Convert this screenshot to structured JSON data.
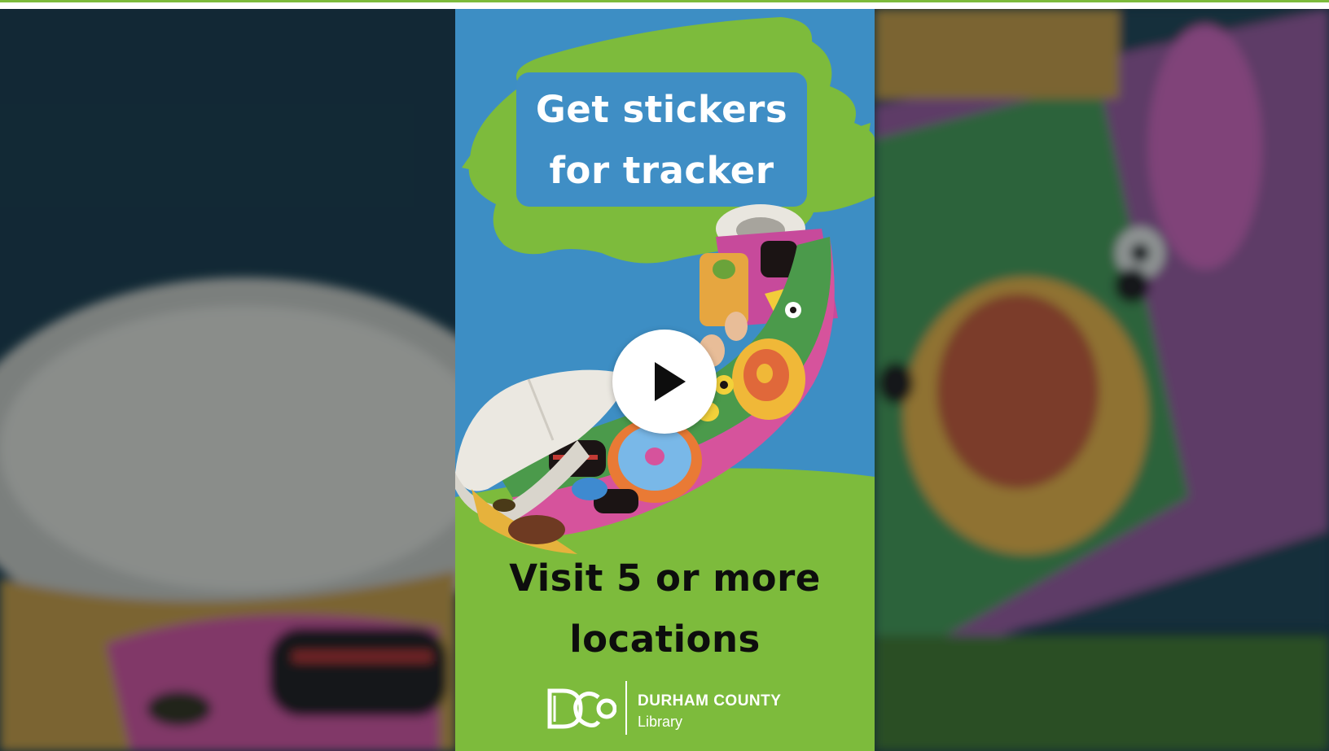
{
  "video": {
    "title_lines": [
      "Get stickers",
      "for tracker"
    ],
    "caption_lines": [
      "Visit 5 or more",
      "locations"
    ],
    "brand": {
      "mark": "DCO",
      "name": "DURHAM COUNTY",
      "sub": "Library"
    }
  },
  "player": {
    "play_icon": "play-icon"
  },
  "colors": {
    "sky_blue": "#3d8ec4",
    "lime_green": "#7dbb3c",
    "title_box": "#3f8ec5",
    "backdrop": "#132a38"
  }
}
